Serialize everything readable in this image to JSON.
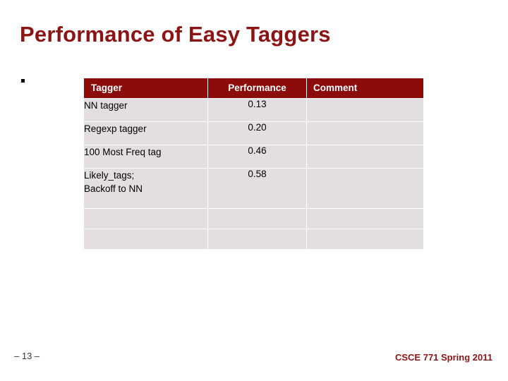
{
  "slide": {
    "title": "Performance of Easy Taggers",
    "bullet_marker": "",
    "footer_left": "– 13 –",
    "footer_right": "CSCE 771 Spring 2011",
    "colors": {
      "title": "#8c1414",
      "header_bg": "#8c0b0b",
      "header_text": "#ffffff",
      "row_bg": "#e3dfe0",
      "footer_right": "#8c1414"
    }
  },
  "table": {
    "headers": [
      "Tagger",
      "Performance",
      "Comment"
    ],
    "rows": [
      {
        "tagger": "NN tagger",
        "performance": "0.13",
        "comment": ""
      },
      {
        "tagger": "Regexp tagger",
        "performance": "0.20",
        "comment": ""
      },
      {
        "tagger": "100 Most Freq tag",
        "performance": "0.46",
        "comment": ""
      },
      {
        "tagger": "Likely_tags;\nBackoff to NN",
        "performance": "0.58",
        "comment": ""
      },
      {
        "tagger": "",
        "performance": "",
        "comment": ""
      },
      {
        "tagger": "",
        "performance": "",
        "comment": ""
      }
    ]
  }
}
